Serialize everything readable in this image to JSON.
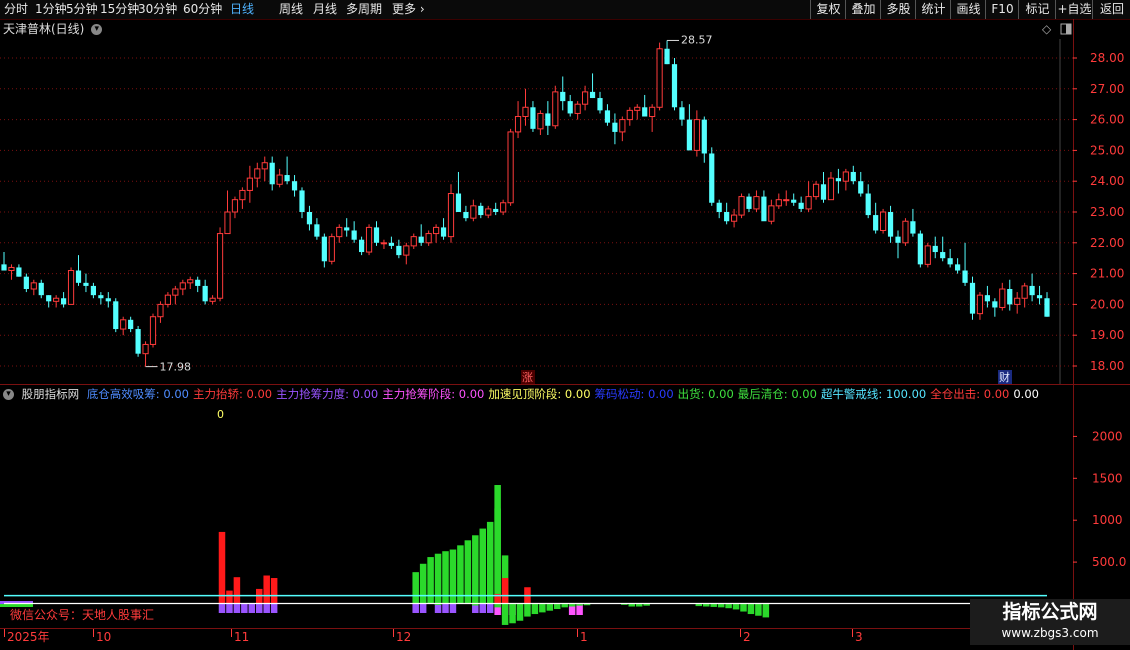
{
  "toolbar": {
    "periods": [
      "分时",
      "1分钟",
      "5分钟",
      "15分钟",
      "30分钟",
      "60分钟",
      "日线",
      "周线",
      "月线",
      "多周期",
      "更多"
    ],
    "active_period": "日线",
    "actions": [
      "复权",
      "叠加",
      "多股",
      "统计",
      "画线",
      "F10",
      "标记",
      "+自选",
      "返回"
    ]
  },
  "main_chart": {
    "title": "天津普林(日线)",
    "price_axis_labels": [
      "28.00",
      "27.00",
      "26.00",
      "25.00",
      "24.00",
      "23.00",
      "22.00",
      "21.00",
      "20.00",
      "19.00",
      "18.00"
    ],
    "high_label": "28.57",
    "low_label": "17.98",
    "badge_zhang": "涨",
    "badge_cai": "财",
    "candles": [
      [
        21.3,
        21.7,
        21.1,
        21.1
      ],
      [
        21.1,
        21.3,
        20.8,
        21.2
      ],
      [
        21.2,
        21.3,
        20.9,
        20.9
      ],
      [
        20.9,
        21.0,
        20.4,
        20.5
      ],
      [
        20.5,
        20.8,
        20.3,
        20.7
      ],
      [
        20.7,
        20.8,
        20.2,
        20.3
      ],
      [
        20.3,
        20.3,
        19.9,
        20.1
      ],
      [
        20.1,
        20.3,
        19.9,
        20.2
      ],
      [
        20.2,
        20.4,
        19.9,
        20.0
      ],
      [
        20.0,
        21.2,
        20.0,
        21.1
      ],
      [
        21.1,
        21.6,
        20.6,
        20.7
      ],
      [
        20.7,
        21.0,
        20.4,
        20.6
      ],
      [
        20.6,
        20.7,
        20.2,
        20.3
      ],
      [
        20.3,
        20.4,
        20.0,
        20.2
      ],
      [
        20.2,
        20.4,
        19.9,
        20.1
      ],
      [
        20.1,
        20.2,
        19.1,
        19.2
      ],
      [
        19.2,
        19.6,
        19.0,
        19.5
      ],
      [
        19.5,
        19.6,
        19.1,
        19.2
      ],
      [
        19.2,
        19.3,
        18.3,
        18.4
      ],
      [
        18.4,
        18.8,
        17.98,
        18.7
      ],
      [
        18.7,
        19.7,
        18.6,
        19.6
      ],
      [
        19.6,
        20.1,
        19.4,
        20.0
      ],
      [
        20.0,
        20.4,
        19.9,
        20.3
      ],
      [
        20.3,
        20.6,
        20.0,
        20.5
      ],
      [
        20.5,
        20.8,
        20.3,
        20.7
      ],
      [
        20.7,
        20.9,
        20.5,
        20.8
      ],
      [
        20.8,
        20.9,
        20.4,
        20.6
      ],
      [
        20.6,
        20.8,
        20.0,
        20.1
      ],
      [
        20.1,
        20.3,
        20.0,
        20.2
      ],
      [
        20.2,
        22.5,
        20.1,
        22.3
      ],
      [
        22.3,
        23.7,
        22.3,
        23.0
      ],
      [
        23.0,
        23.5,
        22.8,
        23.4
      ],
      [
        23.4,
        23.8,
        23.1,
        23.7
      ],
      [
        23.7,
        24.5,
        23.3,
        24.1
      ],
      [
        24.1,
        24.6,
        23.8,
        24.4
      ],
      [
        24.4,
        24.8,
        24.0,
        24.6
      ],
      [
        24.6,
        24.8,
        23.7,
        23.9
      ],
      [
        23.9,
        24.4,
        23.8,
        24.2
      ],
      [
        24.2,
        24.8,
        23.9,
        24.0
      ],
      [
        24.0,
        24.2,
        23.5,
        23.7
      ],
      [
        23.7,
        23.8,
        22.8,
        23.0
      ],
      [
        23.0,
        23.2,
        22.4,
        22.6
      ],
      [
        22.6,
        22.8,
        22.1,
        22.2
      ],
      [
        22.2,
        22.3,
        21.2,
        21.4
      ],
      [
        21.4,
        22.3,
        21.3,
        22.2
      ],
      [
        22.2,
        22.6,
        22.0,
        22.5
      ],
      [
        22.5,
        22.8,
        22.2,
        22.4
      ],
      [
        22.4,
        22.7,
        22.0,
        22.1
      ],
      [
        22.1,
        22.2,
        21.6,
        21.7
      ],
      [
        21.7,
        22.6,
        21.6,
        22.5
      ],
      [
        22.5,
        22.7,
        21.9,
        22.0
      ],
      [
        22.0,
        22.1,
        21.8,
        22.0
      ],
      [
        22.0,
        22.2,
        21.8,
        21.9
      ],
      [
        21.9,
        22.1,
        21.5,
        21.6
      ],
      [
        21.6,
        22.0,
        21.3,
        21.9
      ],
      [
        21.9,
        22.3,
        21.8,
        22.2
      ],
      [
        22.2,
        22.6,
        21.9,
        22.0
      ],
      [
        22.0,
        22.4,
        21.9,
        22.3
      ],
      [
        22.3,
        22.6,
        22.0,
        22.5
      ],
      [
        22.5,
        22.8,
        22.1,
        22.2
      ],
      [
        22.2,
        23.9,
        22.0,
        23.6
      ],
      [
        23.6,
        24.3,
        23.4,
        23.0
      ],
      [
        23.0,
        23.2,
        22.7,
        22.8
      ],
      [
        22.8,
        23.4,
        22.7,
        23.2
      ],
      [
        23.2,
        23.3,
        22.8,
        22.9
      ],
      [
        22.9,
        23.2,
        22.8,
        23.1
      ],
      [
        23.1,
        23.3,
        22.9,
        23.0
      ],
      [
        23.0,
        23.4,
        22.9,
        23.3
      ],
      [
        23.3,
        25.7,
        23.2,
        25.6
      ],
      [
        25.6,
        26.6,
        25.4,
        26.1
      ],
      [
        26.1,
        27.0,
        25.8,
        26.4
      ],
      [
        26.4,
        26.6,
        25.6,
        25.7
      ],
      [
        25.7,
        26.3,
        25.5,
        26.2
      ],
      [
        26.2,
        26.6,
        25.5,
        25.8
      ],
      [
        25.8,
        27.1,
        25.7,
        26.9
      ],
      [
        26.9,
        27.4,
        26.3,
        26.6
      ],
      [
        26.6,
        26.8,
        26.1,
        26.2
      ],
      [
        26.2,
        26.6,
        26.0,
        26.5
      ],
      [
        26.5,
        27.1,
        26.3,
        26.9
      ],
      [
        26.9,
        27.5,
        26.7,
        26.7
      ],
      [
        26.7,
        26.9,
        26.2,
        26.3
      ],
      [
        26.3,
        26.5,
        25.8,
        25.9
      ],
      [
        25.9,
        26.2,
        25.2,
        25.6
      ],
      [
        25.6,
        26.1,
        25.3,
        26.0
      ],
      [
        26.0,
        26.4,
        25.8,
        26.3
      ],
      [
        26.3,
        26.5,
        26.0,
        26.4
      ],
      [
        26.4,
        26.8,
        26.1,
        26.1
      ],
      [
        26.1,
        26.5,
        25.6,
        26.4
      ],
      [
        26.4,
        28.5,
        26.3,
        28.3
      ],
      [
        28.3,
        28.57,
        27.8,
        27.8
      ],
      [
        27.8,
        28.0,
        26.3,
        26.4
      ],
      [
        26.4,
        26.6,
        25.8,
        26.0
      ],
      [
        26.0,
        26.5,
        25.7,
        25.0
      ],
      [
        25.0,
        26.3,
        24.8,
        26.0
      ],
      [
        26.0,
        26.1,
        24.6,
        24.9
      ],
      [
        24.9,
        25.1,
        23.2,
        23.3
      ],
      [
        23.3,
        23.4,
        22.8,
        23.0
      ],
      [
        23.0,
        23.3,
        22.6,
        22.7
      ],
      [
        22.7,
        23.1,
        22.5,
        22.9
      ],
      [
        22.9,
        23.6,
        22.8,
        23.5
      ],
      [
        23.5,
        23.6,
        23.0,
        23.1
      ],
      [
        23.1,
        23.7,
        23.0,
        23.5
      ],
      [
        23.5,
        23.7,
        22.8,
        22.7
      ],
      [
        22.7,
        23.4,
        22.6,
        23.2
      ],
      [
        23.2,
        23.6,
        23.1,
        23.4
      ],
      [
        23.4,
        23.7,
        23.2,
        23.4
      ],
      [
        23.4,
        23.6,
        23.2,
        23.3
      ],
      [
        23.3,
        23.5,
        23.0,
        23.1
      ],
      [
        23.1,
        24.0,
        23.0,
        23.5
      ],
      [
        23.5,
        24.0,
        23.4,
        23.9
      ],
      [
        23.9,
        24.3,
        23.3,
        23.4
      ],
      [
        23.4,
        24.3,
        23.4,
        24.1
      ],
      [
        24.1,
        24.4,
        23.6,
        24.0
      ],
      [
        24.0,
        24.4,
        23.7,
        24.3
      ],
      [
        24.3,
        24.5,
        23.9,
        24.0
      ],
      [
        24.0,
        24.3,
        23.5,
        23.6
      ],
      [
        23.6,
        23.9,
        22.8,
        22.9
      ],
      [
        22.9,
        23.3,
        22.3,
        22.4
      ],
      [
        22.4,
        23.1,
        22.3,
        23.0
      ],
      [
        23.0,
        23.2,
        22.0,
        22.2
      ],
      [
        22.2,
        22.4,
        21.5,
        22.0
      ],
      [
        22.0,
        22.8,
        21.9,
        22.7
      ],
      [
        22.7,
        23.1,
        22.2,
        22.3
      ],
      [
        22.3,
        22.4,
        21.2,
        21.3
      ],
      [
        21.3,
        22.0,
        21.2,
        21.9
      ],
      [
        21.9,
        22.2,
        21.5,
        21.7
      ],
      [
        21.7,
        22.2,
        21.4,
        21.5
      ],
      [
        21.5,
        21.8,
        21.2,
        21.3
      ],
      [
        21.3,
        21.5,
        21.0,
        21.1
      ],
      [
        21.1,
        22.0,
        20.6,
        20.7
      ],
      [
        20.7,
        20.9,
        19.5,
        19.7
      ],
      [
        19.7,
        20.4,
        19.5,
        20.3
      ],
      [
        20.3,
        20.6,
        19.9,
        20.1
      ],
      [
        20.1,
        20.2,
        19.6,
        19.9
      ],
      [
        19.9,
        20.7,
        19.8,
        20.5
      ],
      [
        20.5,
        20.8,
        19.8,
        20.0
      ],
      [
        20.0,
        20.4,
        19.7,
        20.2
      ],
      [
        20.2,
        20.7,
        19.9,
        20.6
      ],
      [
        20.6,
        21.0,
        20.1,
        20.3
      ],
      [
        20.3,
        20.6,
        20.0,
        20.2
      ],
      [
        20.2,
        20.4,
        19.6,
        19.6
      ]
    ]
  },
  "indicator": {
    "name": "股朋指标网",
    "legend": [
      {
        "label": "底仓高效吸筹:",
        "value": "0.00",
        "color": "#4f8cff"
      },
      {
        "label": "主力抬轿:",
        "value": "0.00",
        "color": "#ff3b3b"
      },
      {
        "label": "主力抢筹力度:",
        "value": "0.00",
        "color": "#9a54ff"
      },
      {
        "label": "主力抢筹阶段:",
        "value": "0.00",
        "color": "#ff54ff"
      },
      {
        "label": "加速见顶阶段:",
        "value": "0.00",
        "color": "#ffff66"
      },
      {
        "label": "筹码松动:",
        "value": "0.00",
        "color": "#2a3bff"
      },
      {
        "label": "出货:",
        "value": "0.00",
        "color": "#3fe03f"
      },
      {
        "label": "最后清仓:",
        "value": "0.00",
        "color": "#3fe03f"
      },
      {
        "label": "超牛警戒线:",
        "value": "100.00",
        "color": "#55e5ff"
      },
      {
        "label": "全仓出击:",
        "value": "0.00",
        "color": "#ff3b3b"
      },
      {
        "label": "",
        "value": "0.00",
        "color": "#ffffff"
      }
    ],
    "zero_marker": "0",
    "axis_labels": [
      "2000",
      "1500",
      "1000",
      "500.0"
    ],
    "warning_line_value": 100,
    "green_bars": [
      {
        "start": 52,
        "values": [
          380,
          480,
          560,
          600,
          630,
          650,
          700,
          760,
          820,
          900,
          980,
          1140
        ]
      },
      {
        "start": 63,
        "values": [
          1420,
          580
        ]
      }
    ],
    "red_bars": [
      {
        "i": 26,
        "v": 860
      },
      {
        "i": 27,
        "v": 160
      },
      {
        "i": 28,
        "v": 320
      },
      {
        "i": 31,
        "v": 180
      },
      {
        "i": 32,
        "v": 340
      },
      {
        "i": 33,
        "v": 310
      },
      {
        "i": 63,
        "v": 120
      },
      {
        "i": 64,
        "v": 310
      },
      {
        "i": 67,
        "v": 200
      }
    ],
    "neg_green": [
      [
        55,
        -12
      ],
      [
        60,
        -18
      ],
      [
        63,
        -40
      ],
      [
        64,
        -250
      ],
      [
        65,
        -230
      ],
      [
        66,
        -200
      ],
      [
        67,
        -150
      ],
      [
        68,
        -120
      ],
      [
        69,
        -100
      ],
      [
        70,
        -80
      ],
      [
        71,
        -60
      ],
      [
        72,
        -40
      ],
      [
        73,
        -30
      ],
      [
        74,
        -20
      ],
      [
        75,
        -15
      ],
      [
        80,
        -10
      ],
      [
        81,
        -30
      ],
      [
        82,
        -30
      ],
      [
        83,
        -20
      ],
      [
        90,
        -25
      ],
      [
        91,
        -30
      ],
      [
        92,
        -35
      ],
      [
        93,
        -40
      ],
      [
        94,
        -50
      ],
      [
        95,
        -65
      ],
      [
        96,
        -90
      ],
      [
        97,
        -120
      ],
      [
        98,
        -140
      ],
      [
        99,
        -160
      ]
    ]
  },
  "time_axis": [
    "2025年",
    "10",
    "11",
    "12",
    "1",
    "2",
    "3"
  ],
  "watermark_left": "微信公众号：天地人股事汇",
  "watermark_right": {
    "title": "指标公式网",
    "url": "www.zbgs3.com"
  }
}
